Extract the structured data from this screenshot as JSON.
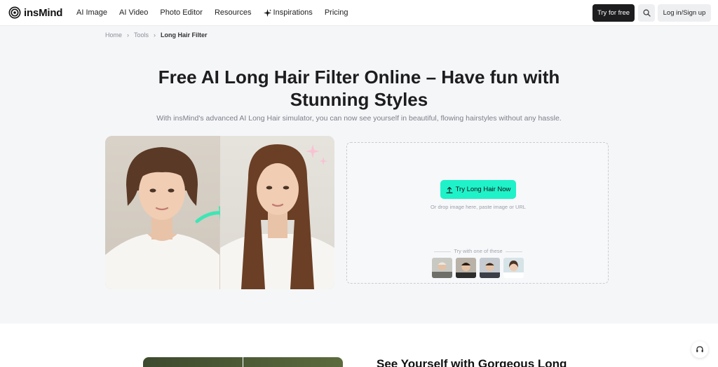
{
  "brand": {
    "name": "insMind"
  },
  "nav": {
    "items": [
      {
        "label": "AI Image"
      },
      {
        "label": "AI Video"
      },
      {
        "label": "Photo Editor"
      },
      {
        "label": "Resources"
      },
      {
        "label": "Inspirations",
        "icon": "sparkle-icon"
      },
      {
        "label": "Pricing"
      }
    ],
    "try_label": "Try for free",
    "login_label": "Log in/Sign up"
  },
  "breadcrumb": {
    "home": "Home",
    "tools": "Tools",
    "current": "Long Hair Filter",
    "separator": "›"
  },
  "hero": {
    "title": "Free AI Long Hair Filter Online – Have fun with Stunning Styles",
    "subtitle": "With insMind's advanced AI Long Hair simulator, you can now see yourself in beautiful, flowing hairstyles without any hassle."
  },
  "upload": {
    "button_label": "Try Long Hair Now",
    "hint": "Or drop image here, paste image or URL",
    "samples_label": "Try with one of these"
  },
  "lower": {
    "title": "See Yourself with Gorgeous Long"
  },
  "colors": {
    "accent": "#1ff2c9",
    "dark": "#1d1d1f",
    "arrow": "#3ee6b4"
  }
}
